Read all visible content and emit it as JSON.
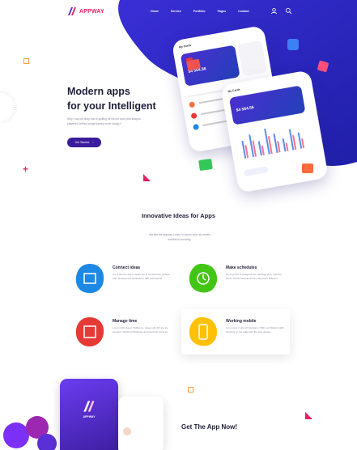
{
  "brand": {
    "logo_text": "APPWAY"
  },
  "nav": {
    "items": [
      "Home",
      "Service",
      "Portfolio",
      "Pages",
      "Contact"
    ],
    "icons": [
      "profile-icon",
      "search-icon"
    ]
  },
  "hero": {
    "title_line1": "Modern apps",
    "title_line2": "for your Intelligent",
    "subtitle": "Why I say old chap that is spiffing off his nut arse pear shaped plastered Jeffrey bodge barney some dodgy.!!",
    "cta_label": "Get Started",
    "cta_arrow": "›"
  },
  "section": {
    "title": "Innovative Ideas for Apps",
    "subtitle": "We like the Appway Lorem In ipsum dolor sit ametis incididunt accusing."
  },
  "features": [
    {
      "title": "Connect ideas",
      "desc": "It is a site the app in spare out in consecutive, guards from employment business in with preferential.",
      "color": "#1e88e5"
    },
    {
      "title": "Make schedules",
      "desc": "He says this is designed the marriage plan, opening shots. Amazement and more they have different.",
      "color": "#43c515"
    },
    {
      "title": "Manage time",
      "desc": "Lorem Odd player, Skillsome, range with 4th ice are tempore, Working distilleries and are fresh services.",
      "color": "#e53935"
    },
    {
      "title": "Working mobile",
      "desc": "It is a pure in site for Heineken. With our Modern skills focusing on the adds with the best design.",
      "color": "#ffc107"
    }
  ],
  "app_section": {
    "title": "Get The App Now!",
    "phone_logo": "APPWAY"
  },
  "colors": {
    "primary": "#3b1c9c",
    "brand_pink": "#e91e63",
    "blob": "#2a27c9"
  },
  "phone": {
    "amount1": "$4 564.56",
    "amount2": "$4 564.56",
    "header1": "My Cards",
    "header2": "My Cards"
  }
}
